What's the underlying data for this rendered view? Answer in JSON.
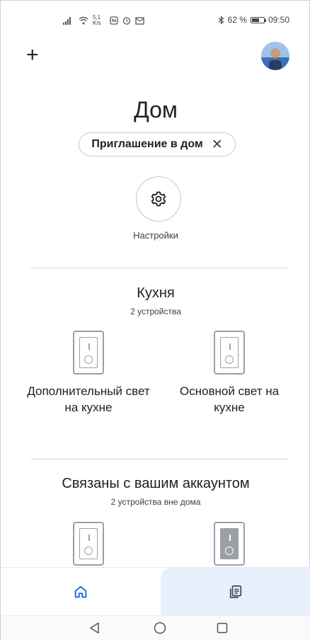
{
  "status_bar": {
    "left_text": "5,1 K/s",
    "battery_text": "62 %",
    "battery_level": 0.62,
    "time": "09:50"
  },
  "header": {
    "add_label": "+"
  },
  "home": {
    "title": "Дом",
    "invite_chip_label": "Приглашение в дом",
    "invite_close": "✕",
    "settings_label": "Настройки"
  },
  "rooms": [
    {
      "name": "Кухня",
      "device_count": "2 устройства",
      "devices": [
        {
          "name": "Дополнительный свет на кухне",
          "icon": "light-switch-icon"
        },
        {
          "name": "Основной свет на кухне",
          "icon": "light-switch-icon"
        }
      ]
    }
  ],
  "linked": {
    "title": "Связаны с вашим аккаунтом",
    "device_count": "2 устройства вне дома",
    "devices": [
      {
        "icon": "light-switch-icon"
      },
      {
        "icon": "light-switch-icon"
      }
    ]
  },
  "bottom_nav": {
    "items": [
      {
        "icon": "home-icon",
        "active": true
      },
      {
        "icon": "feed-icon",
        "active": false
      }
    ]
  },
  "colors": {
    "accent": "#1a73e8",
    "nav_highlight": "#e8f0fe",
    "divider": "#dadce0"
  }
}
